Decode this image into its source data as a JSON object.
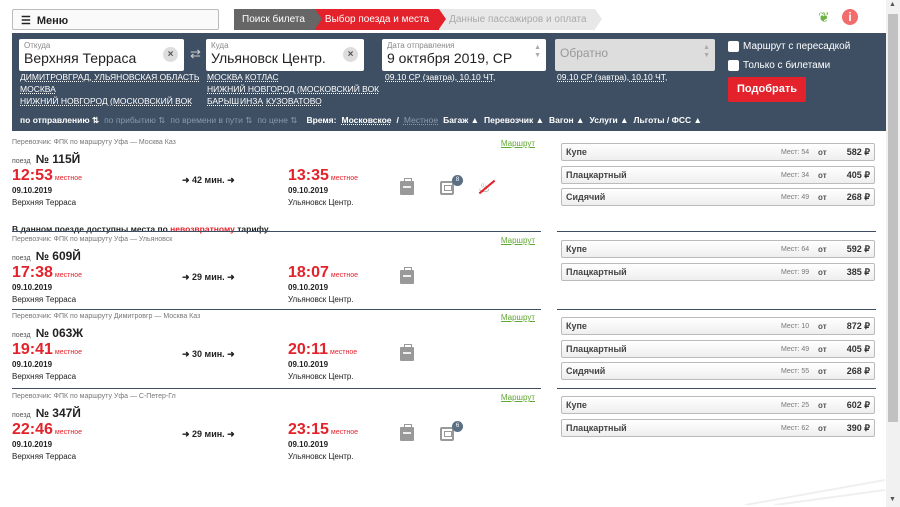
{
  "header": {
    "menu_label": "Меню",
    "steps": [
      "Поиск билета",
      "Выбор поезда и места",
      "Данные пассажиров и оплата"
    ]
  },
  "search": {
    "from": {
      "label": "Откуда",
      "value": "Верхняя Терраса",
      "suggestions": [
        "ДИМИТРОВГРАД, УЛЬЯНОВСКАЯ ОБЛАСТЬ",
        "МОСКВА",
        "НИЖНИЙ НОВГОРОД (МОСКОВСКИЙ ВОК"
      ]
    },
    "to": {
      "label": "Куда",
      "value": "Ульяновск Центр.",
      "suggestions": [
        "МОСКВА",
        "КОТЛАС",
        "НИЖНИЙ НОВГОРОД (МОСКОВСКИЙ ВОК",
        "БАРЫШ",
        "ИНЗА",
        "КУЗОВАТОВО"
      ]
    },
    "date": {
      "label": "Дата отправления",
      "value": "9 октября 2019, СР",
      "hints": "09.10 СР (завтра), 10.10 ЧТ,"
    },
    "back": {
      "value": "Обратно",
      "hints": "09.10 СР (завтра), 10.10 ЧТ,"
    },
    "checks": [
      "Маршрут с пересадкой",
      "Только с билетами"
    ],
    "submit": "Подобрать"
  },
  "sortbar": {
    "by_dep": "по отправлению",
    "by_arr": "по прибытию",
    "by_time": "по времени в пути",
    "by_price": "по цене",
    "time_label": "Время:",
    "tz_msk": "Московское",
    "slash": "/",
    "tz_local": "Местное",
    "filters": [
      "Багаж ▲",
      "Перевозчик ▲",
      "Вагон ▲",
      "Услуги ▲",
      "Льготы / ФСС ▲"
    ]
  },
  "trains": [
    {
      "carrier": "Перевозчик: ФПК   по маршруту Уфа — Москва Каз",
      "route": "Маршрут",
      "poezd": "поезд",
      "num": "№ 115Й",
      "dep_time": "12:53",
      "arr_time": "13:35",
      "local": "местное",
      "duration": "➜ 42 мин. ➜",
      "dep_date": "09.10.2019",
      "arr_date": "09.10.2019",
      "dep_station": "Верхняя Терраса",
      "arr_station": "Ульяновск Центр.",
      "car_count": "8",
      "note_pre": "В данном поезде доступны места по ",
      "note_red": "невозвратному",
      "note_post": " тарифу.",
      "seats": [
        {
          "cls": "Купе",
          "cnt": "Мест: 54",
          "ot": "от",
          "price": "582 ₽"
        },
        {
          "cls": "Плацкартный",
          "cnt": "Мест: 34",
          "ot": "от",
          "price": "405 ₽"
        },
        {
          "cls": "Сидячий",
          "cnt": "Мест: 49",
          "ot": "от",
          "price": "268 ₽"
        }
      ]
    },
    {
      "carrier": "Перевозчик: ФПК   по маршруту Уфа — Ульяновск",
      "route": "Маршрут",
      "poezd": "поезд",
      "num": "№ 609Й",
      "dep_time": "17:38",
      "arr_time": "18:07",
      "local": "местное",
      "duration": "➜ 29 мин. ➜",
      "dep_date": "09.10.2019",
      "arr_date": "09.10.2019",
      "dep_station": "Верхняя Терраса",
      "arr_station": "Ульяновск Центр.",
      "seats": [
        {
          "cls": "Купе",
          "cnt": "Мест: 64",
          "ot": "от",
          "price": "592 ₽"
        },
        {
          "cls": "Плацкартный",
          "cnt": "Мест: 99",
          "ot": "от",
          "price": "385 ₽"
        }
      ]
    },
    {
      "carrier": "Перевозчик: ФПК   по маршруту Димитровгр — Москва Каз",
      "route": "Маршрут",
      "poezd": "поезд",
      "num": "№ 063Ж",
      "dep_time": "19:41",
      "arr_time": "20:11",
      "local": "местное",
      "duration": "➜ 30 мин. ➜",
      "dep_date": "09.10.2019",
      "arr_date": "09.10.2019",
      "dep_station": "Верхняя Терраса",
      "arr_station": "Ульяновск Центр.",
      "seats": [
        {
          "cls": "Купе",
          "cnt": "Мест: 10",
          "ot": "от",
          "price": "872 ₽"
        },
        {
          "cls": "Плацкартный",
          "cnt": "Мест: 49",
          "ot": "от",
          "price": "405 ₽"
        },
        {
          "cls": "Сидячий",
          "cnt": "Мест: 55",
          "ot": "от",
          "price": "268 ₽"
        }
      ]
    },
    {
      "carrier": "Перевозчик: ФПК   по маршруту Уфа — С-Петер-Гл",
      "route": "Маршрут",
      "poezd": "поезд",
      "num": "№ 347Й",
      "dep_time": "22:46",
      "arr_time": "23:15",
      "local": "местное",
      "duration": "➜ 29 мин. ➜",
      "dep_date": "09.10.2019",
      "arr_date": "09.10.2019",
      "dep_station": "Верхняя Терраса",
      "arr_station": "Ульяновск Центр.",
      "car_count": "6",
      "seats": [
        {
          "cls": "Купе",
          "cnt": "Мест: 25",
          "ot": "от",
          "price": "602 ₽"
        },
        {
          "cls": "Плацкартный",
          "cnt": "Мест: 62",
          "ot": "от",
          "price": "390 ₽"
        }
      ]
    }
  ],
  "colors": {
    "accent": "#e3222b",
    "panel": "#3e4f63",
    "link": "#5fa831"
  }
}
